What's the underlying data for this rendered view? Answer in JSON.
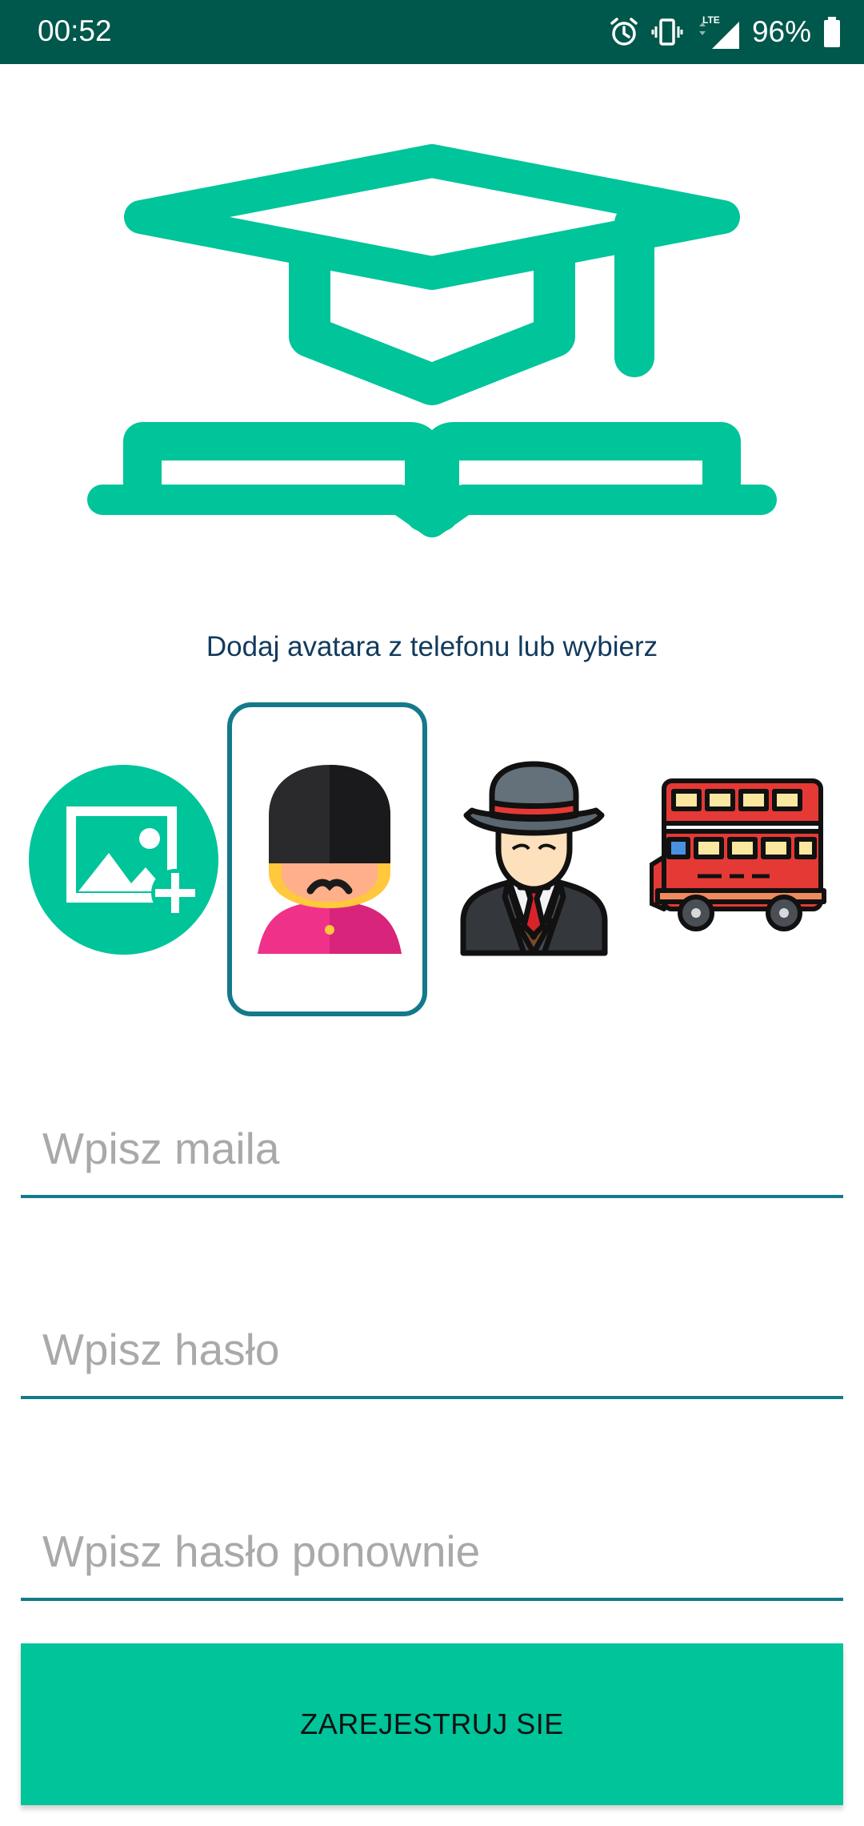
{
  "status_bar": {
    "time": "00:52",
    "network": "LTE",
    "battery_percent": "96%",
    "icons": [
      "alarm-icon",
      "vibrate-icon",
      "signal-icon",
      "battery-icon"
    ]
  },
  "colors": {
    "status_bar": "#00574b",
    "accent": "#00c49a",
    "selection_border": "#127a8a",
    "prompt_text": "#123a5c"
  },
  "logo": {
    "icon": "graduation-cap-book-icon"
  },
  "avatar_prompt": "Dodaj avatara z telefonu lub wybierz",
  "avatars": {
    "add_from_phone_icon": "add-photo-icon",
    "options": [
      "guard-avatar",
      "gentleman-avatar",
      "bus-avatar"
    ],
    "selected": "guard-avatar"
  },
  "form": {
    "email_placeholder": "Wpisz maila",
    "password_placeholder": "Wpisz hasło",
    "password_repeat_placeholder": "Wpisz hasło ponownie",
    "register_label": "ZAREJESTRUJ SIE"
  }
}
